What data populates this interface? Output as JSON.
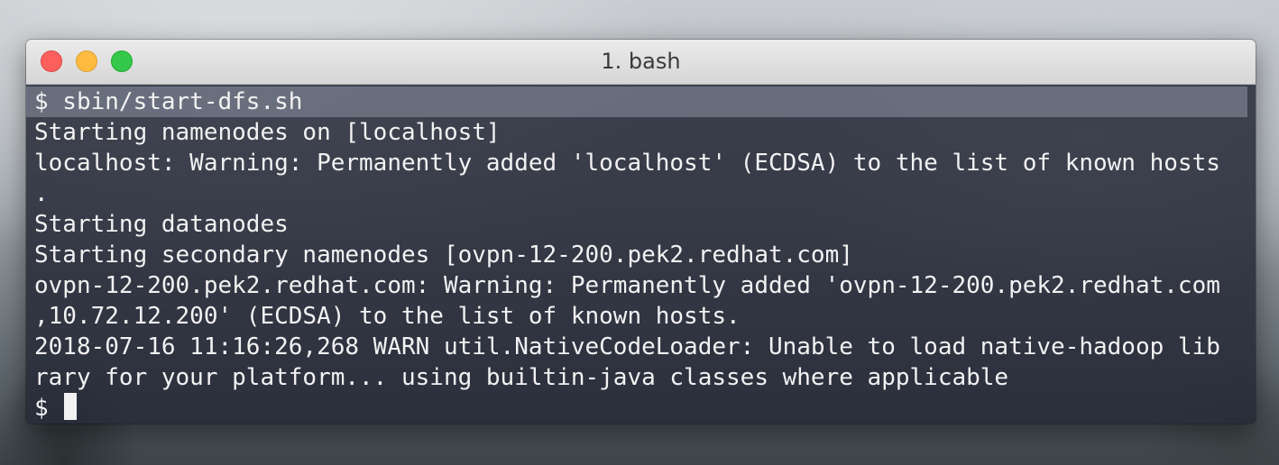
{
  "window": {
    "title": "1. bash"
  },
  "terminal": {
    "lines": [
      "$ sbin/start-dfs.sh",
      "Starting namenodes on [localhost]",
      "localhost: Warning: Permanently added 'localhost' (ECDSA) to the list of known hosts",
      ".",
      "Starting datanodes",
      "Starting secondary namenodes [ovpn-12-200.pek2.redhat.com]",
      "ovpn-12-200.pek2.redhat.com: Warning: Permanently added 'ovpn-12-200.pek2.redhat.com",
      ",10.72.12.200' (ECDSA) to the list of known hosts.",
      "2018-07-16 11:16:26,268 WARN util.NativeCodeLoader: Unable to load native-hadoop lib",
      "rary for your platform... using builtin-java classes where applicable"
    ],
    "prompt": "$ "
  },
  "colors": {
    "close": "#fc605c",
    "minimize": "#fdbc40",
    "zoom": "#34c84a",
    "terminal_bg": "#262a38",
    "terminal_fg": "#f2f2f2"
  }
}
